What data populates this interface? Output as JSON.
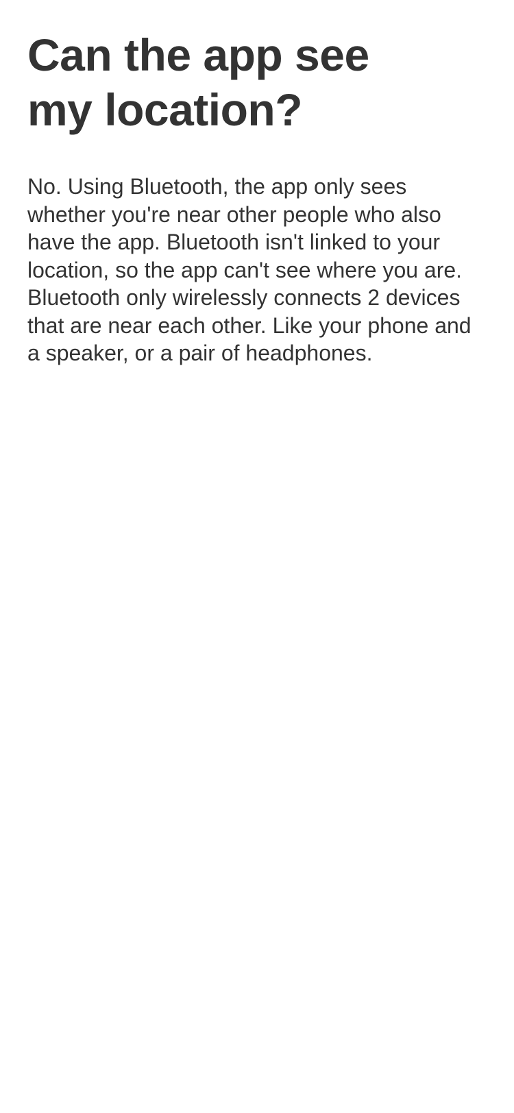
{
  "page": {
    "title": "Can the app see my location?",
    "body": "No. Using Bluetooth, the app only sees whether you're near other people who also have the app. Bluetooth isn't linked to your location, so the app can't see where you are. Bluetooth only wirelessly connects 2 devices that are near each other. Like your phone and a speaker, or a pair of headphones."
  },
  "colors": {
    "background": "#ffffff",
    "text": "#333333"
  }
}
